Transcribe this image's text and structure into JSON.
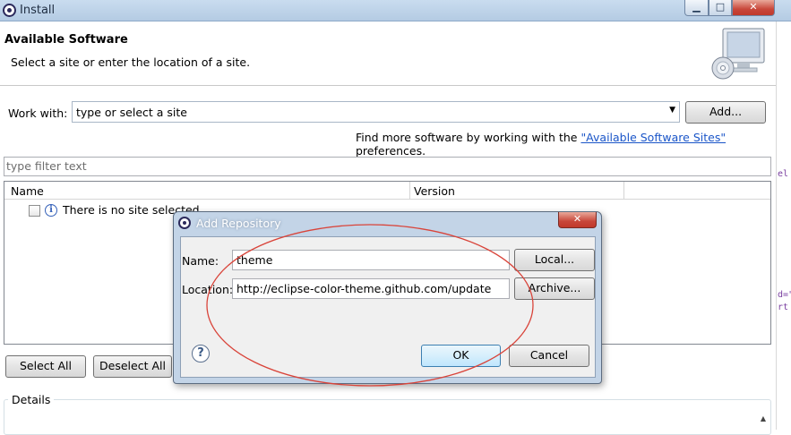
{
  "window": {
    "title": "Install",
    "minimize": "▁",
    "maximize": "□",
    "close": "✕"
  },
  "header": {
    "title": "Available Software",
    "description": "Select a site or enter the location of a site."
  },
  "work_with": {
    "label": "Work with:",
    "value": "type or select a site",
    "add_button": "Add..."
  },
  "find_more": {
    "prefix": "Find more software by working with the ",
    "link": "\"Available Software Sites\"",
    "suffix": " preferences."
  },
  "filter": {
    "placeholder": "type filter text"
  },
  "table": {
    "columns": [
      "Name",
      "Version"
    ],
    "rows": [
      {
        "text": "There is no site selected."
      }
    ]
  },
  "buttons": {
    "select_all": "Select All",
    "deselect_all": "Deselect All"
  },
  "details": {
    "label": "Details"
  },
  "dialog": {
    "title": "Add Repository",
    "close": "✕",
    "name_label": "Name:",
    "name_value": "theme",
    "location_label": "Location:",
    "location_value": "http://eclipse-color-theme.github.com/update",
    "local_button": "Local...",
    "archive_button": "Archive...",
    "help": "?",
    "ok_button": "OK",
    "cancel_button": "Cancel"
  },
  "colors": {
    "link": "#1a55c8",
    "annotation_ellipse": "#d9443a",
    "dialog_frame": "#c3d4e7"
  }
}
